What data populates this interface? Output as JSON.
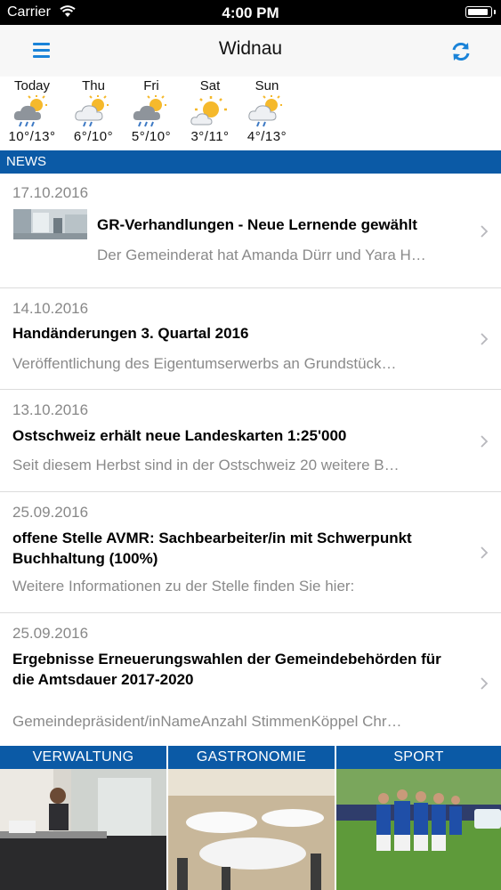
{
  "status_bar": {
    "carrier": "Carrier",
    "time": "4:00 PM"
  },
  "nav": {
    "title": "Widnau",
    "menu_icon": "hamburger-menu-icon",
    "refresh_icon": "refresh-icon"
  },
  "weather": [
    {
      "day": "Today",
      "temp": "10°/13°",
      "icon": "cloud-sun-rain-icon"
    },
    {
      "day": "Thu",
      "temp": "6°/10°",
      "icon": "cloud-sun-rain-icon"
    },
    {
      "day": "Fri",
      "temp": "5°/10°",
      "icon": "cloud-sun-rain-icon"
    },
    {
      "day": "Sat",
      "temp": "3°/11°",
      "icon": "sun-cloud-icon"
    },
    {
      "day": "Sun",
      "temp": "4°/13°",
      "icon": "cloud-sun-rain-icon"
    }
  ],
  "news": {
    "header": "NEWS",
    "items": [
      {
        "date": "17.10.2016",
        "title": "GR-Verhandlungen - Neue Lernende gewählt",
        "teaser": "Der Gemeinderat hat Amanda Dürr und Yara H…",
        "has_thumb": true
      },
      {
        "date": "14.10.2016",
        "title": "Handänderungen 3. Quartal 2016",
        "teaser": "Veröffentlichung des Eigentumserwerbs an Grundstück…"
      },
      {
        "date": "13.10.2016",
        "title": "Ostschweiz erhält neue Landeskarten 1:25'000",
        "teaser": "Seit diesem Herbst sind in der Ostschweiz 20 weitere B…"
      },
      {
        "date": "25.09.2016",
        "title": "offene Stelle AVMR: Sachbearbeiter/in mit Schwerpunkt Buchhaltung (100%)",
        "teaser": "Weitere Informationen zu der Stelle finden Sie hier:"
      },
      {
        "date": "25.09.2016",
        "title": "Ergebnisse Erneuerungswahlen der Gemeindebehörden für die Amtsdauer 2017-2020",
        "teaser": "Gemeindepräsident/inNameAnzahl StimmenKöppel Chr…"
      }
    ]
  },
  "tiles": [
    {
      "label": "VERWALTUNG"
    },
    {
      "label": "GASTRONOMIE"
    },
    {
      "label": "SPORT"
    }
  ],
  "colors": {
    "accent": "#1a83d8",
    "section_blue": "#0b5aa6"
  }
}
